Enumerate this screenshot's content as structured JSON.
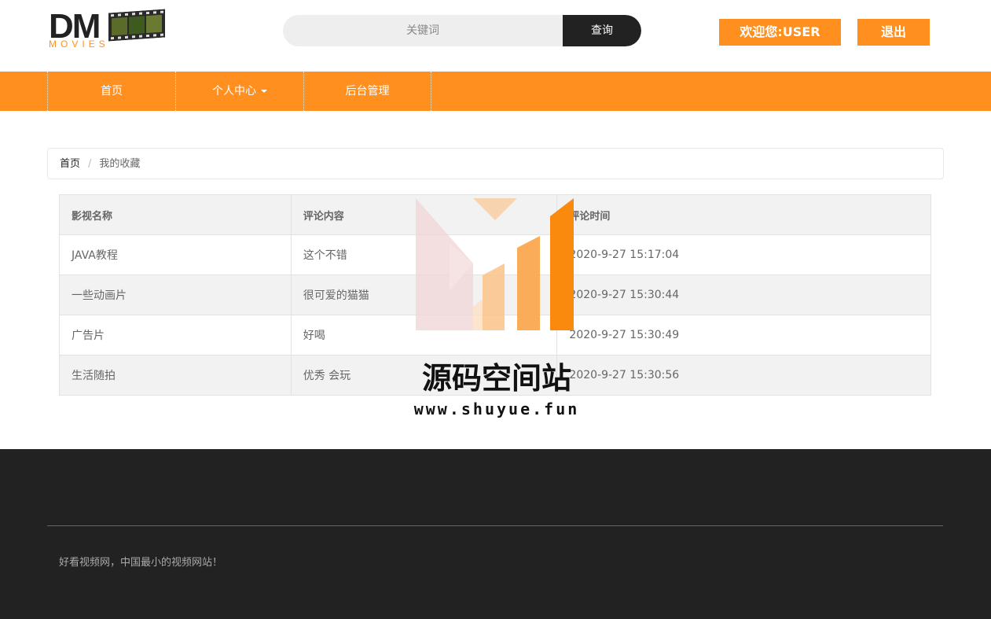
{
  "header": {
    "logo_text": "DM",
    "logo_sub": "MOVIES",
    "search": {
      "placeholder": "关键词",
      "button_label": "查询"
    },
    "welcome_label": "欢迎您:USER",
    "logout_label": "退出"
  },
  "nav": {
    "items": [
      {
        "label": "首页"
      },
      {
        "label": "个人中心"
      },
      {
        "label": "后台管理"
      }
    ]
  },
  "breadcrumb": {
    "home": "首页",
    "separator": "/",
    "current": "我的收藏"
  },
  "table": {
    "headers": [
      "影视名称",
      "评论内容",
      "评论时间"
    ],
    "rows": [
      [
        "JAVA教程",
        "这个不错",
        "2020-9-27 15:17:04"
      ],
      [
        "一些动画片",
        "很可爱的猫猫",
        "2020-9-27 15:30:44"
      ],
      [
        "广告片",
        "好喝",
        "2020-9-27 15:30:49"
      ],
      [
        "生活随拍",
        "优秀 会玩",
        "2020-9-27 15:30:56"
      ]
    ]
  },
  "watermark": {
    "text": "源码空间站",
    "url": "www.shuyue.fun"
  },
  "footer": {
    "copyright": "好看视频网，中国最小的视频网站！"
  },
  "colors": {
    "accent": "#ff8f1f",
    "dark": "#222222"
  }
}
